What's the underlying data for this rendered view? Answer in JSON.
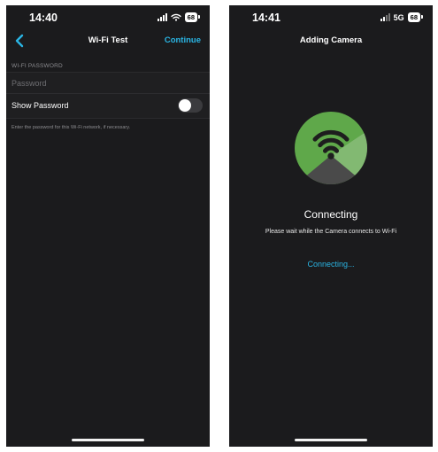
{
  "left_screen": {
    "status_bar": {
      "time": "14:40",
      "battery": "68"
    },
    "nav": {
      "title": "Wi-Fi Test",
      "action": "Continue"
    },
    "section_header": "WI-FI PASSWORD",
    "password": {
      "placeholder": "Password",
      "value": ""
    },
    "show_password": {
      "label": "Show Password",
      "enabled": false
    },
    "helper_text": "Enter the password for this Wi-Fi network, if necessary."
  },
  "right_screen": {
    "status_bar": {
      "time": "14:41",
      "network": "5G",
      "battery": "68"
    },
    "nav": {
      "title": "Adding Camera"
    },
    "status_title": "Connecting",
    "status_message": "Please wait while the Camera connects to Wi-Fi",
    "status_link": "Connecting..."
  },
  "colors": {
    "background": "#1b1b1d",
    "accent": "#2ab5e4",
    "graphic_green": "#5fa84a",
    "text": "#ffffff"
  },
  "icons": [
    "signal-icon",
    "wifi-icon",
    "battery-icon",
    "chevron-left-icon",
    "wifi-camera-icon"
  ]
}
